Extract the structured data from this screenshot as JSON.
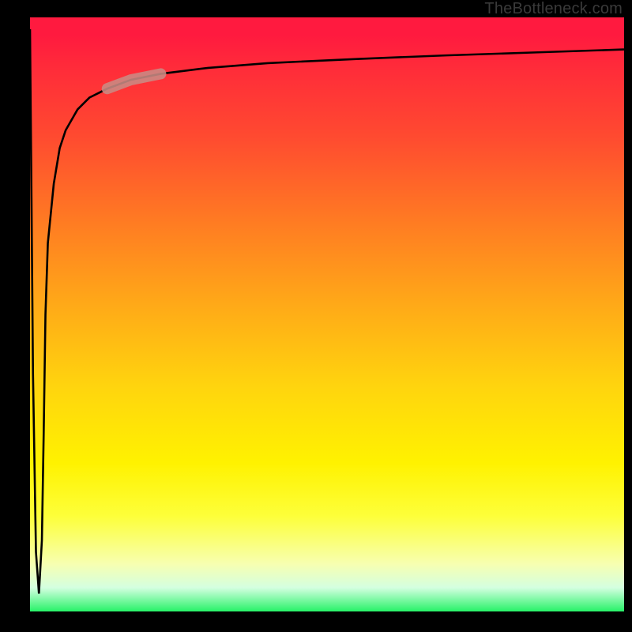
{
  "watermark": "TheBottleneck.com",
  "chart_data": {
    "type": "line",
    "title": "",
    "xlabel": "",
    "ylabel": "",
    "xlim": [
      0,
      100
    ],
    "ylim": [
      0,
      100
    ],
    "grid": false,
    "series": [
      {
        "name": "bottleneck-curve",
        "x": [
          0.0,
          0.2,
          0.5,
          1.0,
          1.5,
          2.0,
          2.3,
          2.6,
          3.0,
          4.0,
          5.0,
          6.0,
          8.0,
          10.0,
          13.0,
          17.0,
          22.0,
          30.0,
          40.0,
          55.0,
          70.0,
          85.0,
          100.0
        ],
        "y": [
          98.0,
          75.0,
          40.0,
          10.0,
          3.0,
          12.0,
          30.0,
          50.0,
          62.0,
          72.0,
          78.0,
          81.0,
          84.5,
          86.5,
          88.0,
          89.5,
          90.5,
          91.5,
          92.3,
          93.0,
          93.6,
          94.1,
          94.6
        ]
      }
    ],
    "highlight": {
      "name": "highlight-segment",
      "x_range": [
        13.0,
        22.0
      ],
      "y_range": [
        88.0,
        90.5
      ],
      "color": "#c98b84"
    }
  },
  "colors": {
    "curve": "#000000",
    "highlight": "#c98b84",
    "background_top": "#ff1a3f",
    "background_bottom": "#27f268"
  }
}
